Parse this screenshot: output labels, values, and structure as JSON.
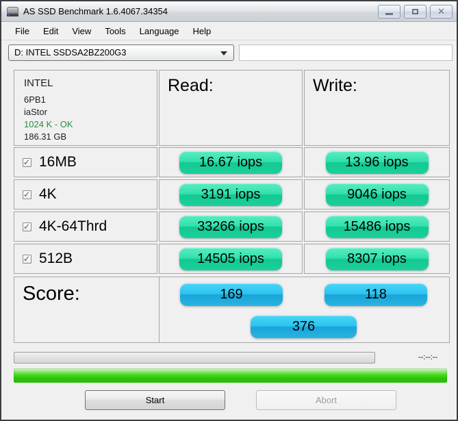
{
  "window": {
    "title": "AS SSD Benchmark 1.6.4067.34354"
  },
  "menu": {
    "items": [
      "File",
      "Edit",
      "View",
      "Tools",
      "Language",
      "Help"
    ]
  },
  "drive_selector": {
    "value": "D: INTEL SSDSA2BZ200G3"
  },
  "filename_box": {
    "value": ""
  },
  "drive_info": {
    "vendor": "INTEL",
    "firmware": "6PB1",
    "driver": "iaStor",
    "alignment": "1024 K - OK",
    "capacity": "186.31 GB"
  },
  "columns": {
    "read": "Read:",
    "write": "Write:"
  },
  "tests": [
    {
      "label": "16MB",
      "checked": true,
      "read": "16.67 iops",
      "write": "13.96 iops"
    },
    {
      "label": "4K",
      "checked": true,
      "read": "3191 iops",
      "write": "9046 iops"
    },
    {
      "label": "4K-64Thrd",
      "checked": true,
      "read": "33266 iops",
      "write": "15486 iops"
    },
    {
      "label": "512B",
      "checked": true,
      "read": "14505 iops",
      "write": "8307 iops"
    }
  ],
  "score": {
    "label": "Score:",
    "read": "169",
    "write": "118",
    "total": "376"
  },
  "progress": {
    "time": "--:--:--"
  },
  "buttons": {
    "start": "Start",
    "abort": "Abort"
  },
  "icons": {
    "checkmark": "✓",
    "close": "✕"
  },
  "colors": {
    "result_pill_green": "#1ed3a0",
    "score_pill_blue": "#29b9e8",
    "alignment_ok_green": "#2e8b46",
    "overall_progress_green": "#2cc709"
  }
}
